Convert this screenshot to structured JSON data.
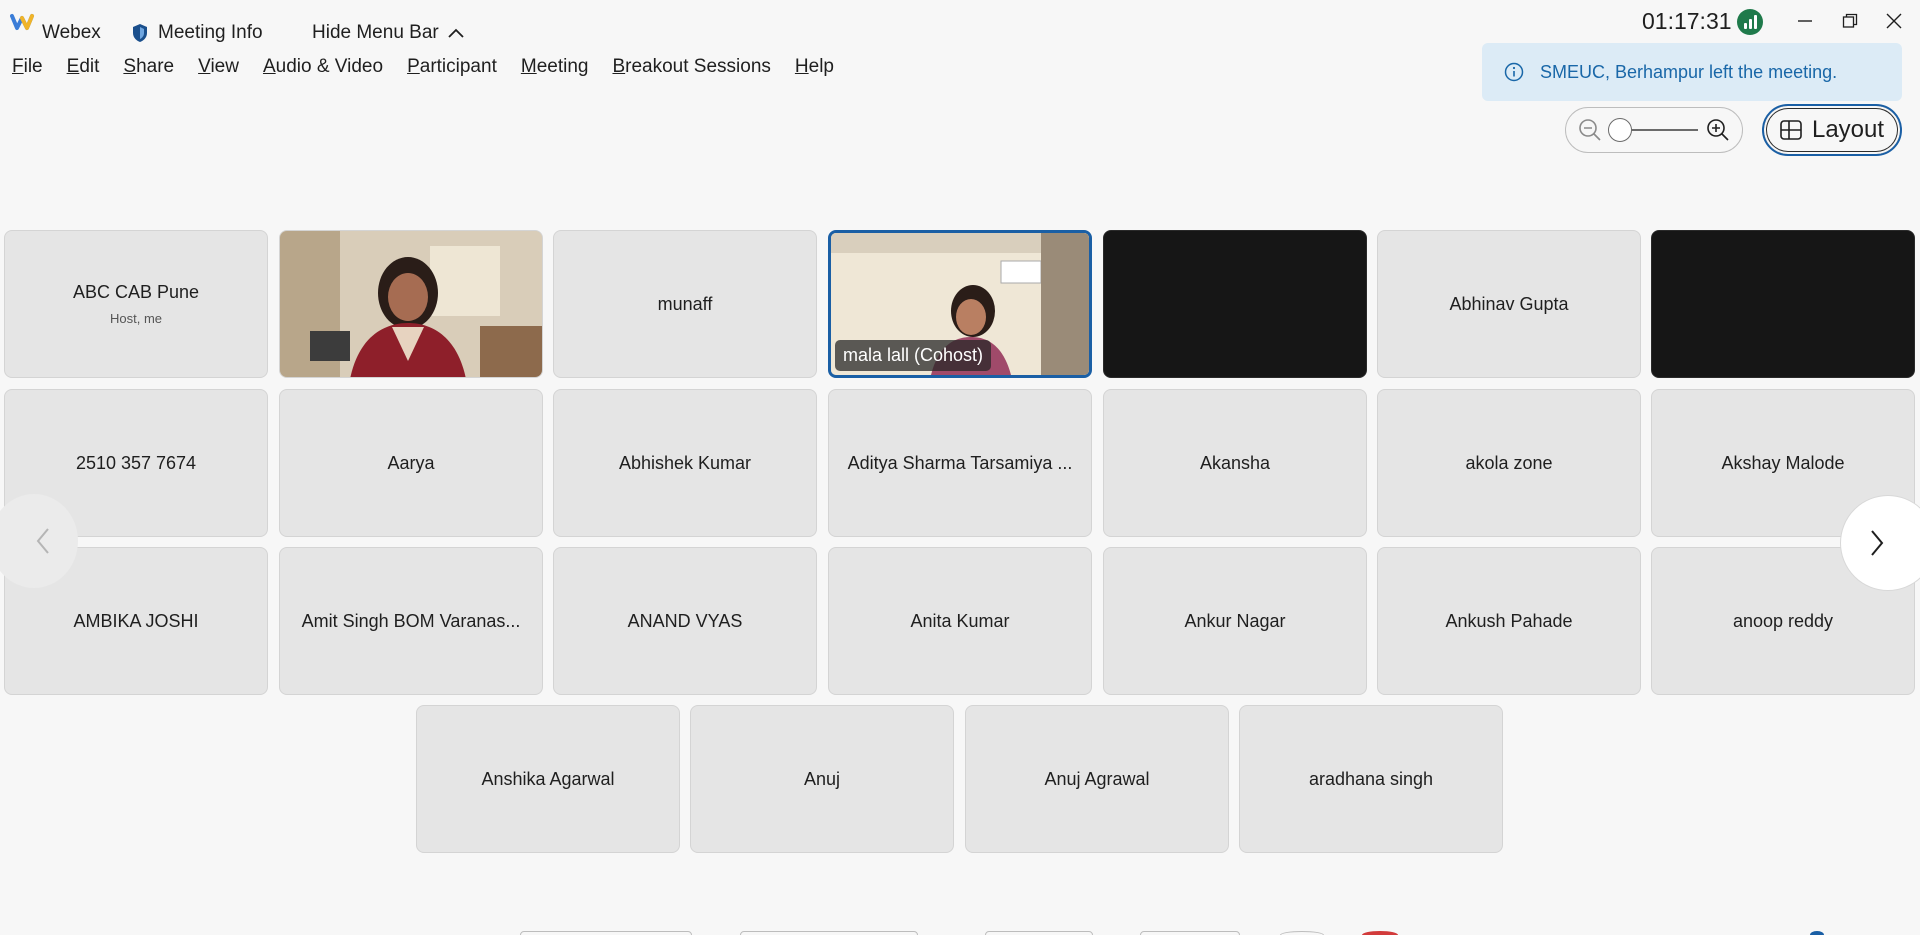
{
  "titlebar": {
    "app_name": "Webex",
    "meeting_info": "Meeting Info",
    "hide_menu": "Hide Menu Bar",
    "clock": "01:17:31"
  },
  "menu": [
    "File",
    "Edit",
    "Share",
    "View",
    "Audio & Video",
    "Participant",
    "Meeting",
    "Breakout Sessions",
    "Help"
  ],
  "toast": {
    "text": "SMEUC, Berhampur left the meeting."
  },
  "layout_button": {
    "label": "Layout"
  },
  "tiles": [
    {
      "name": "ABC CAB Pune",
      "sub": "Host, me"
    },
    {
      "name": "",
      "sub": ""
    },
    {
      "name": "munaff",
      "sub": ""
    },
    {
      "name": "mala lall (Cohost)",
      "sub": ""
    },
    {
      "name": "",
      "sub": ""
    },
    {
      "name": "Abhinav Gupta",
      "sub": ""
    },
    {
      "name": "",
      "sub": ""
    },
    {
      "name": "2510 357 7674",
      "sub": ""
    },
    {
      "name": "Aarya",
      "sub": ""
    },
    {
      "name": "Abhishek Kumar",
      "sub": ""
    },
    {
      "name": "Aditya Sharma Tarsamiya ...",
      "sub": ""
    },
    {
      "name": "Akansha",
      "sub": ""
    },
    {
      "name": "akola zone",
      "sub": ""
    },
    {
      "name": "Akshay Malode",
      "sub": ""
    },
    {
      "name": "AMBIKA JOSHI",
      "sub": ""
    },
    {
      "name": "Amit Singh BOM Varanas...",
      "sub": ""
    },
    {
      "name": "ANAND VYAS",
      "sub": ""
    },
    {
      "name": "Anita Kumar",
      "sub": ""
    },
    {
      "name": "Ankur Nagar",
      "sub": ""
    },
    {
      "name": "Ankush Pahade",
      "sub": ""
    },
    {
      "name": "anoop reddy",
      "sub": ""
    },
    {
      "name": "Anshika Agarwal",
      "sub": ""
    },
    {
      "name": "Anuj",
      "sub": ""
    },
    {
      "name": "Anuj Agrawal",
      "sub": ""
    },
    {
      "name": "aradhana singh",
      "sub": ""
    }
  ],
  "colors": {
    "accent": "#1a5fa5",
    "toast_bg": "#dcebf6",
    "toast_text": "#1967a8",
    "signal": "#1f7a4b"
  }
}
